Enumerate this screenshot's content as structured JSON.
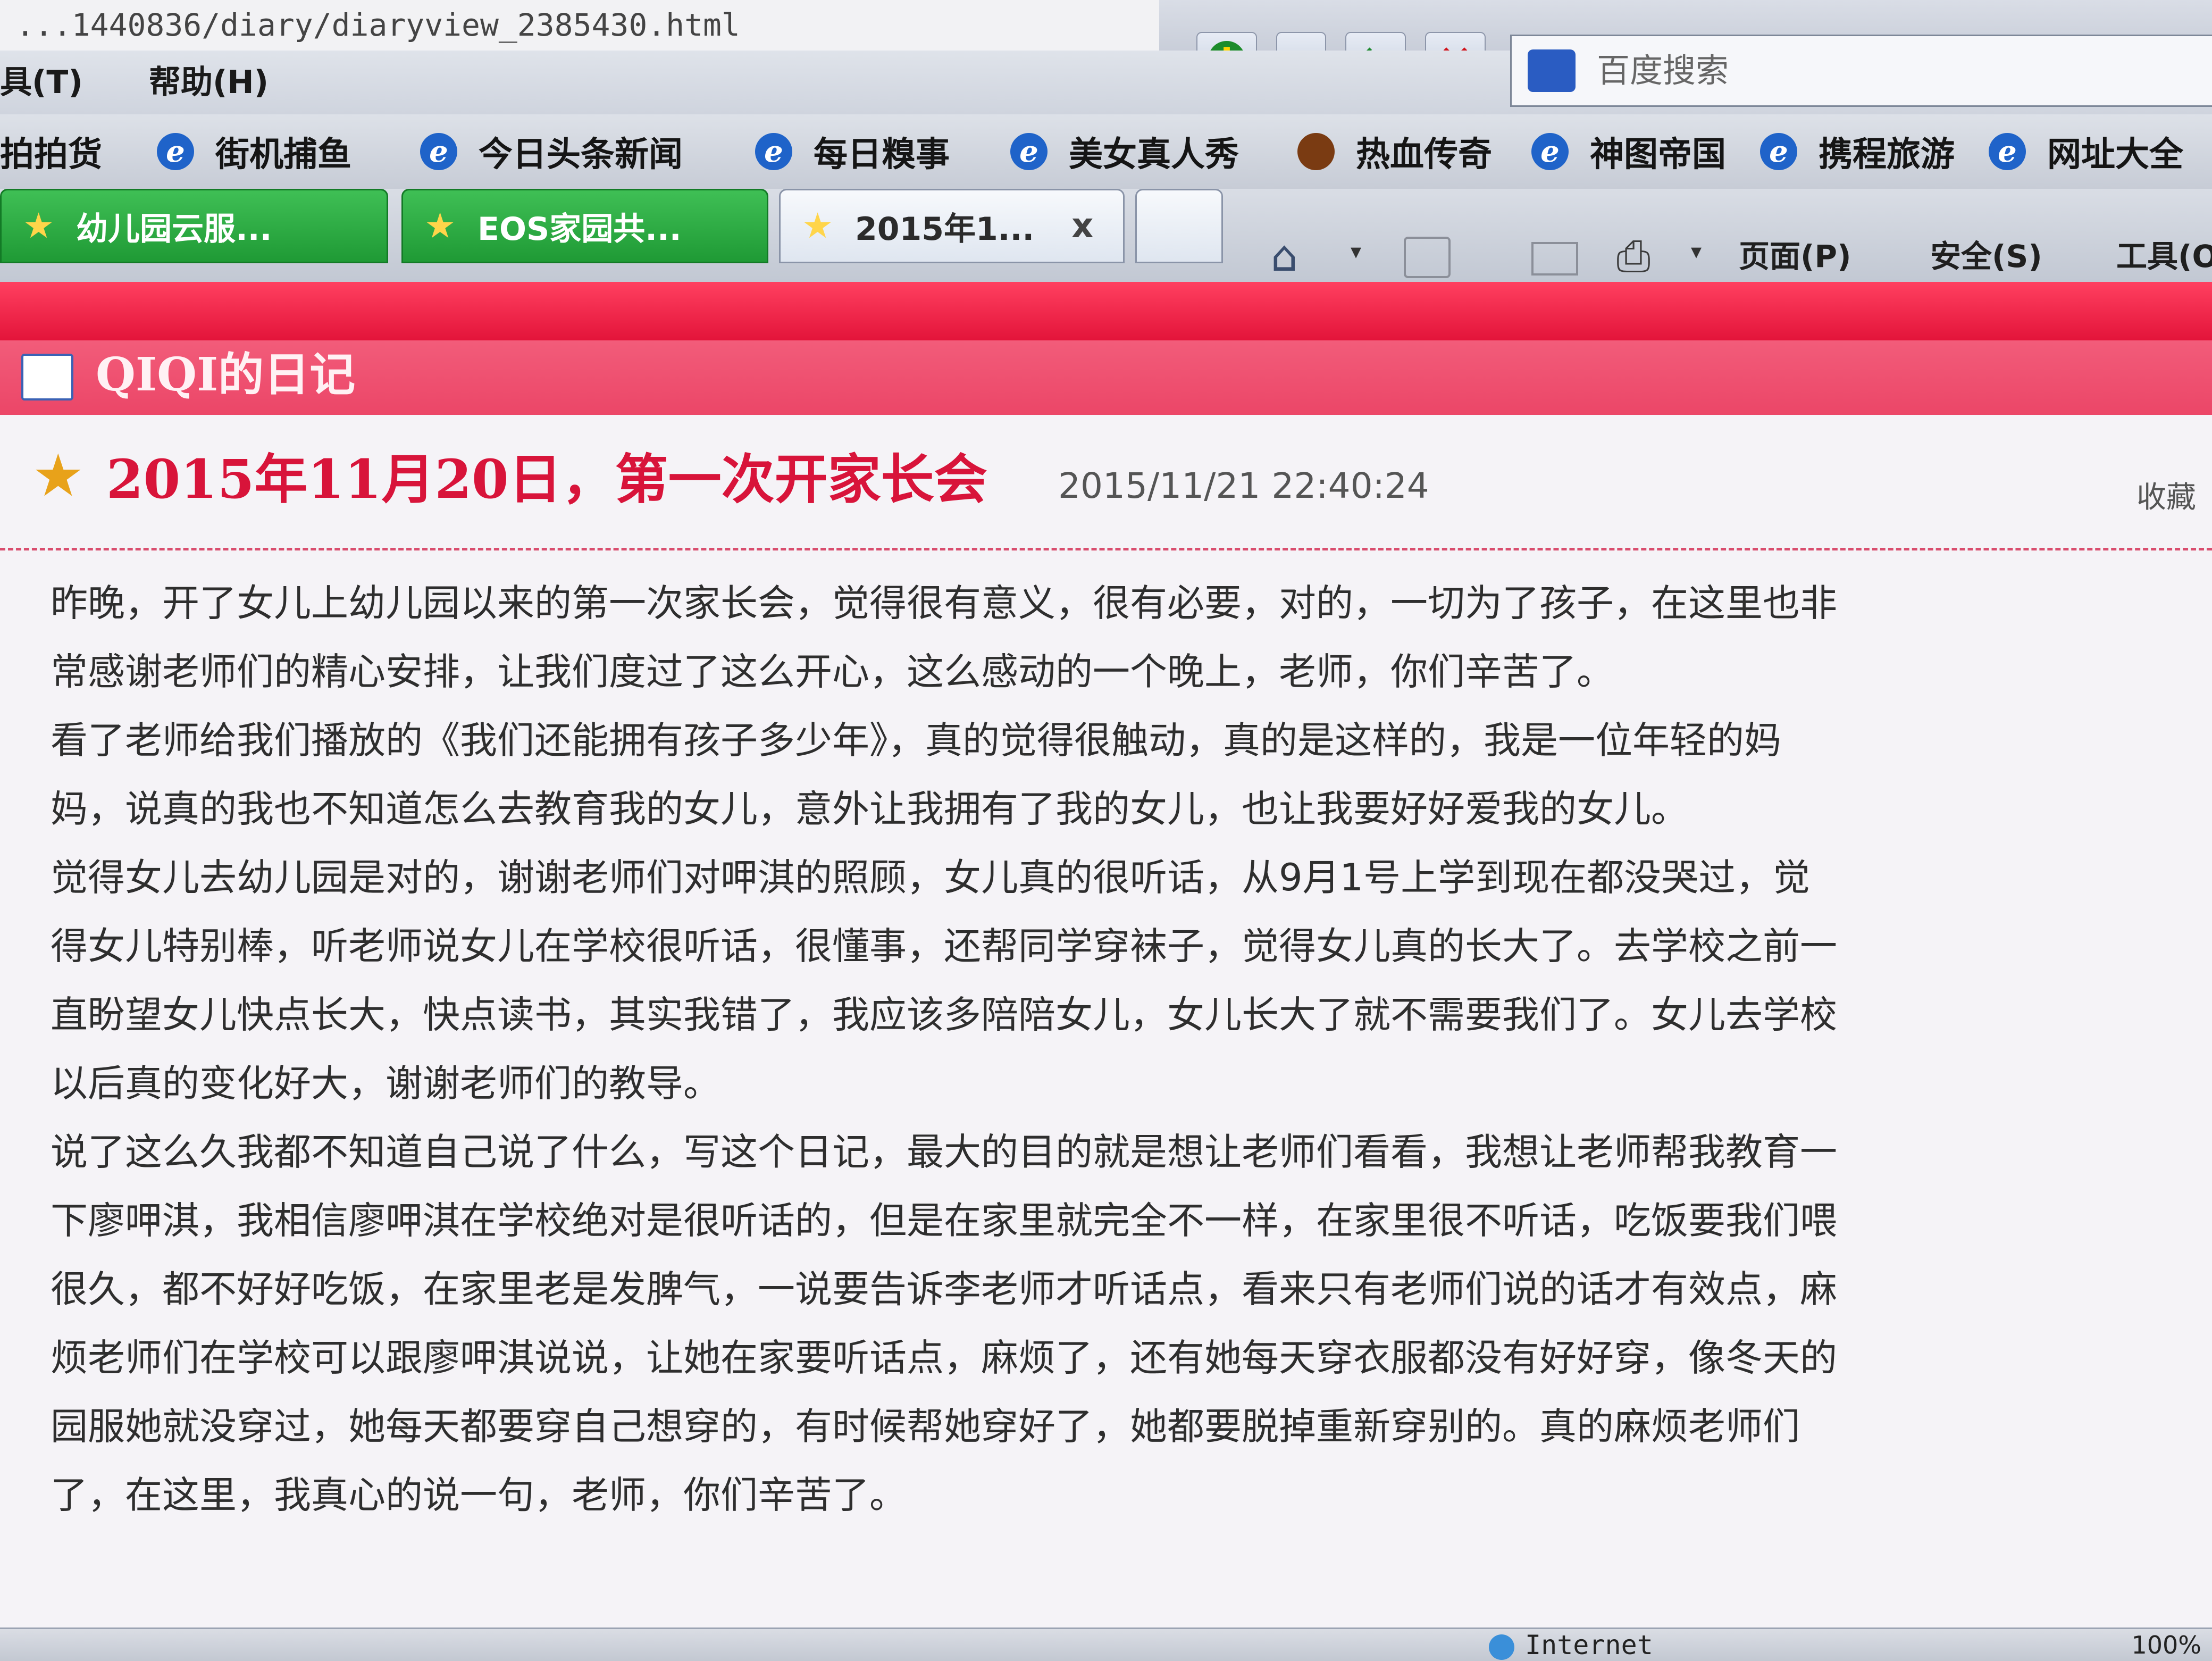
{
  "browser": {
    "address_text": "...1440836/diary/diaryview_2385430.html",
    "search_label": "百度搜索",
    "zone_text": "Internet",
    "zoom_text": "100%"
  },
  "menu": {
    "items": [
      "具(T)",
      "帮助(H)"
    ]
  },
  "favorites": {
    "items": [
      "拍拍货",
      "街机捕鱼",
      "今日头条新闻",
      "每日糗事",
      "美女真人秀",
      "热血传奇",
      "神图帝国",
      "携程旅游",
      "网址大全"
    ]
  },
  "tabs": {
    "items": [
      "幼儿园云服...",
      "EOS家园共...",
      "2015年1..."
    ],
    "close_label": "x"
  },
  "commands": {
    "page": "页面(P)",
    "safety": "安全(S)",
    "tools": "工具(O)"
  },
  "diary": {
    "header_title": "QIQI的日记",
    "post_title": "2015年11月20日，第一次开家长会",
    "post_date": "2015/11/21 22:40:24",
    "favorite_label": "收藏",
    "lines": [
      "昨晚，开了女儿上幼儿园以来的第一次家长会，觉得很有意义，很有必要，对的，一切为了孩子，在这里也非",
      "常感谢老师们的精心安排，让我们度过了这么开心，这么感动的一个晚上，老师，你们辛苦了。",
      "看了老师给我们播放的《我们还能拥有孩子多少年》，真的觉得很触动，真的是这样的，我是一位年轻的妈",
      "妈，说真的我也不知道怎么去教育我的女儿，意外让我拥有了我的女儿，也让我要好好爱我的女儿。",
      "觉得女儿去幼儿园是对的，谢谢老师们对呷淇的照顾，女儿真的很听话，从9月1号上学到现在都没哭过，觉",
      "得女儿特别棒，听老师说女儿在学校很听话，很懂事，还帮同学穿袜子，觉得女儿真的长大了。去学校之前一",
      "直盼望女儿快点长大，快点读书，其实我错了，我应该多陪陪女儿，女儿长大了就不需要我们了。女儿去学校",
      "以后真的变化好大，谢谢老师们的教导。",
      "说了这么久我都不知道自己说了什么，写这个日记，最大的目的就是想让老师们看看，我想让老师帮我教育一",
      "下廖呷淇，我相信廖呷淇在学校绝对是很听话的，但是在家里就完全不一样，在家里很不听话，吃饭要我们喂",
      "很久，都不好好吃饭，在家里老是发脾气，一说要告诉李老师才听话点，看来只有老师们说的话才有效点，麻",
      "烦老师们在学校可以跟廖呷淇说说，让她在家要听话点，麻烦了，还有她每天穿衣服都没有好好穿，像冬天的",
      "园服她就没穿过，她每天都要穿自己想穿的，有时候帮她穿好了，她都要脱掉重新穿别的。真的麻烦老师们",
      "了，在这里，我真心的说一句，老师，你们辛苦了。"
    ]
  },
  "colors": {
    "red_band": "#e3143a",
    "header_pink": "#ec4a6c",
    "title_red": "#d8143a",
    "tab_green": "#1f9a35"
  }
}
